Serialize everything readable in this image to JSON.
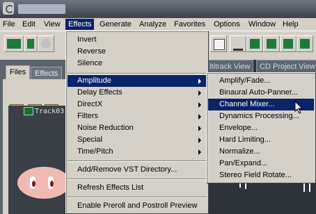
{
  "menubar": {
    "items": [
      {
        "label": "File"
      },
      {
        "label": "Edit"
      },
      {
        "label": "View"
      },
      {
        "label": "Effects"
      },
      {
        "label": "Generate"
      },
      {
        "label": "Analyze"
      },
      {
        "label": "Favorites"
      },
      {
        "label": "Options"
      },
      {
        "label": "Window"
      },
      {
        "label": "Help"
      }
    ]
  },
  "left_panel": {
    "tabs": [
      {
        "label": "Files"
      },
      {
        "label": "Effects"
      }
    ],
    "track_name": "Track03"
  },
  "main_tabs": [
    {
      "label": "ltitrack View"
    },
    {
      "label": "CD Project View"
    }
  ],
  "effects_menu": {
    "items": [
      {
        "label": "Invert"
      },
      {
        "label": "Reverse"
      },
      {
        "label": "Silence"
      },
      {
        "label": "Amplitude"
      },
      {
        "label": "Delay Effects"
      },
      {
        "label": "DirectX"
      },
      {
        "label": "Filters"
      },
      {
        "label": "Noise Reduction"
      },
      {
        "label": "Special"
      },
      {
        "label": "Time/Pitch"
      },
      {
        "label": "Add/Remove VST Directory..."
      },
      {
        "label": "Refresh Effects List"
      },
      {
        "label": "Enable Preroll and Postroll Preview"
      }
    ]
  },
  "amplitude_submenu": {
    "items": [
      {
        "label": "Amplify/Fade..."
      },
      {
        "label": "Binaural Auto-Panner..."
      },
      {
        "label": "Channel Mixer..."
      },
      {
        "label": "Dynamics Processing..."
      },
      {
        "label": "Envelope..."
      },
      {
        "label": "Hard Limiting..."
      },
      {
        "label": "Normalize..."
      },
      {
        "label": "Pan/Expand..."
      },
      {
        "label": "Stereo Field Rotate..."
      }
    ]
  }
}
